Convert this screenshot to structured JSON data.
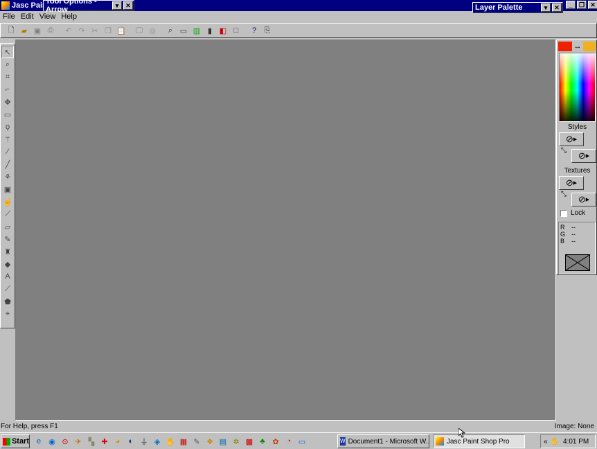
{
  "app": {
    "title": "Jasc Paint Shop Pro",
    "title_truncated": "Jasc Pain",
    "menu": [
      "File",
      "Edit",
      "View",
      "Help"
    ]
  },
  "tool_options": {
    "title": "Tool Options - Arrow"
  },
  "layer_palette": {
    "title": "Layer Palette"
  },
  "toolbar": {
    "icons": [
      "new-icon",
      "open-icon",
      "save-icon",
      "print-icon",
      "undo-icon",
      "redo-icon",
      "cut-icon",
      "copy-icon",
      "paste-icon",
      "browse-icon",
      "screen-icon",
      "zoom-icon",
      "ruler-icon",
      "color-icon",
      "histogram-icon",
      "layers-icon",
      "overview-icon",
      "help-icon",
      "twain-icon"
    ]
  },
  "tools": [
    "arrow-icon",
    "zoom-icon",
    "deform-icon",
    "crop-icon",
    "mover-icon",
    "selection-icon",
    "lasso-icon",
    "magic-wand-icon",
    "dropper-icon",
    "paintbrush-icon",
    "clone-icon",
    "color-replacer-icon",
    "retouch-icon",
    "scratch-remover-icon",
    "eraser-icon",
    "picture-tube-icon",
    "airbrush-icon",
    "flood-fill-icon",
    "text-icon",
    "line-icon",
    "shape-icon",
    "vector-icon"
  ],
  "color_panel": {
    "foreground": "#ee2200",
    "background": "#f0b020",
    "styles_label": "Styles",
    "textures_label": "Textures",
    "lock_label": "Lock",
    "r_label": "R",
    "g_label": "G",
    "b_label": "B",
    "r_value": "--",
    "g_value": "--",
    "b_value": "--"
  },
  "status": {
    "help": "For Help, press F1",
    "image": "Image: None"
  },
  "taskbar": {
    "start": "Start",
    "tasks": [
      "Document1 - Microsoft W...",
      "Jasc Paint Shop Pro"
    ],
    "time": "4:01 PM",
    "tray_arrow": "«"
  },
  "colors": {
    "canvas": "#808080",
    "chrome": "#c0c0c0",
    "titlebar": "#000080"
  }
}
